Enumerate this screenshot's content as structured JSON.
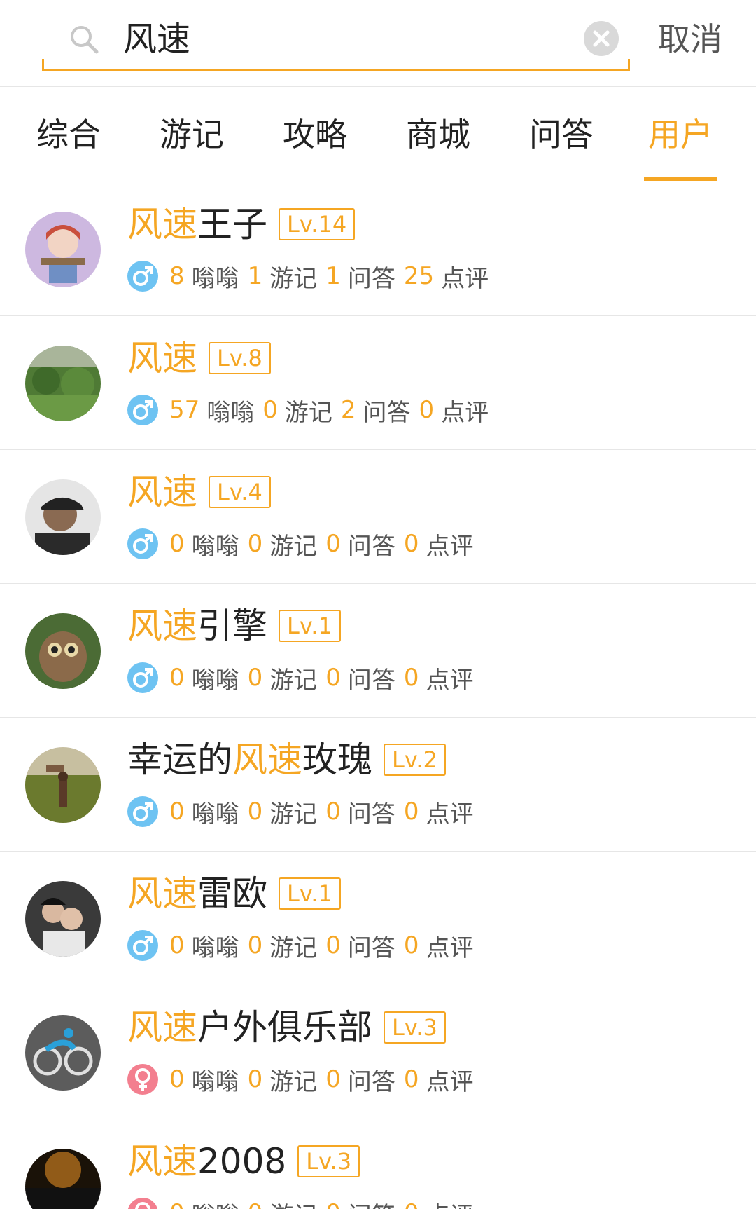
{
  "search": {
    "query": "风速",
    "cancel_label": "取消"
  },
  "tabs": [
    {
      "label": "综合"
    },
    {
      "label": "游记"
    },
    {
      "label": "攻略"
    },
    {
      "label": "商城"
    },
    {
      "label": "问答"
    },
    {
      "label": "用户"
    }
  ],
  "colors": {
    "accent": "#f5a623",
    "male": "#6ec3f2",
    "female": "#f37f8f"
  },
  "stat_labels": {
    "wengweng": "嗡嗡",
    "youji": "游记",
    "wenda": "问答",
    "dianping": "点评"
  },
  "users": [
    {
      "name_pre": "",
      "name_hl": "风速",
      "name_post": "王子",
      "level": "Lv.14",
      "gender": "male",
      "wengweng": "8",
      "youji": "1",
      "wenda": "1",
      "dianping": "25",
      "avatar": "anime-girl-avatar"
    },
    {
      "name_pre": "",
      "name_hl": "风速",
      "name_post": "",
      "level": "Lv.8",
      "gender": "male",
      "wengweng": "57",
      "youji": "0",
      "wenda": "2",
      "dianping": "0",
      "avatar": "green-field-avatar"
    },
    {
      "name_pre": "",
      "name_hl": "风速",
      "name_post": "",
      "level": "Lv.4",
      "gender": "male",
      "wengweng": "0",
      "youji": "0",
      "wenda": "0",
      "dianping": "0",
      "avatar": "man-cap-avatar"
    },
    {
      "name_pre": "",
      "name_hl": "风速",
      "name_post": "引擎",
      "level": "Lv.1",
      "gender": "male",
      "wengweng": "0",
      "youji": "0",
      "wenda": "0",
      "dianping": "0",
      "avatar": "owl-avatar"
    },
    {
      "name_pre": "幸运的",
      "name_hl": "风速",
      "name_post": "玫瑰",
      "level": "Lv.2",
      "gender": "male",
      "wengweng": "0",
      "youji": "0",
      "wenda": "0",
      "dianping": "0",
      "avatar": "grassland-horse-avatar"
    },
    {
      "name_pre": "",
      "name_hl": "风速",
      "name_post": "雷欧",
      "level": "Lv.1",
      "gender": "male",
      "wengweng": "0",
      "youji": "0",
      "wenda": "0",
      "dianping": "0",
      "avatar": "couple-avatar"
    },
    {
      "name_pre": "",
      "name_hl": "风速",
      "name_post": "户外俱乐部",
      "level": "Lv.3",
      "gender": "female",
      "wengweng": "0",
      "youji": "0",
      "wenda": "0",
      "dianping": "0",
      "avatar": "cyclist-logo-avatar"
    },
    {
      "name_pre": "",
      "name_hl": "风速",
      "name_post": "2008",
      "level": "Lv.3",
      "gender": "female",
      "wengweng": "0",
      "youji": "0",
      "wenda": "0",
      "dianping": "0",
      "avatar": "fireworks-2014-avatar"
    }
  ]
}
